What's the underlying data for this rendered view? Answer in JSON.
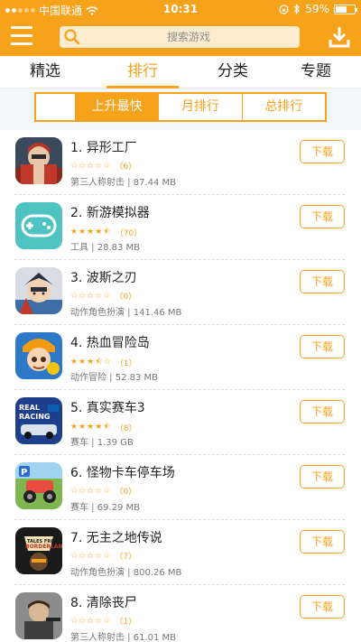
{
  "status": {
    "carrier": "中国联通",
    "time": "10:31",
    "battery": "59%",
    "battery_level": 0.59
  },
  "search": {
    "placeholder": "搜索游戏"
  },
  "tabs": [
    {
      "label": "精选"
    },
    {
      "label": "排行"
    },
    {
      "label": "分类"
    },
    {
      "label": "专题"
    }
  ],
  "active_tab": "排行",
  "subtabs": [
    {
      "label": "上升最快"
    },
    {
      "label": "月排行"
    },
    {
      "label": "总排行"
    }
  ],
  "active_subtab": "上升最快",
  "colors": {
    "accent": "#f7a21b",
    "background": "#ffffff"
  },
  "download_label": "下载",
  "apps": [
    {
      "title": "1. 异形工厂",
      "rating": 0,
      "count": "（6）",
      "meta": "第三人称射击 | 87.44 MB",
      "icon": "alien-factory-icon"
    },
    {
      "title": "2. 新游模拟器",
      "rating": 4.5,
      "count": "（70）",
      "meta": "工具 | 28.83 MB",
      "icon": "gamepad-icon"
    },
    {
      "title": "3. 波斯之刃",
      "rating": 0,
      "count": "（0）",
      "meta": "动作角色扮演 | 141.46 MB",
      "icon": "persian-blade-icon"
    },
    {
      "title": "4. 热血冒险岛",
      "rating": 3.5,
      "count": "（1）",
      "meta": "动作冒险 | 52.83 MB",
      "icon": "adventure-island-icon"
    },
    {
      "title": "5. 真实赛车3",
      "rating": 4.5,
      "count": "（8）",
      "meta": "赛车 | 1.39 GB",
      "icon": "real-racing-icon"
    },
    {
      "title": "6. 怪物卡车停车场",
      "rating": 0,
      "count": "（0）",
      "meta": "赛车 | 69.29 MB",
      "icon": "monster-truck-icon"
    },
    {
      "title": "7. 无主之地传说",
      "rating": 0,
      "count": "（7）",
      "meta": "动作角色扮演 | 800.26 MB",
      "icon": "borderlands-icon"
    },
    {
      "title": "8. 清除丧尸",
      "rating": 0,
      "count": "（1）",
      "meta": "第三人称射击 | 61.01 MB",
      "icon": "zombie-icon"
    }
  ]
}
